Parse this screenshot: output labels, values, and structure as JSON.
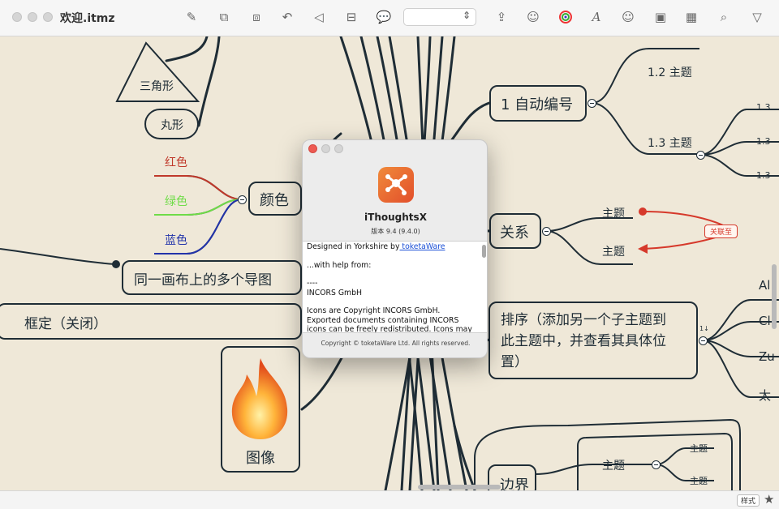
{
  "window": {
    "title": "欢迎.itmz"
  },
  "toolbar": {
    "icons": [
      "edit-icon",
      "add-child-icon",
      "add-sibling-icon",
      "undo-icon",
      "redo-icon",
      "topic-layout-icon",
      "callout-icon",
      "style-select",
      "share-icon",
      "sticker-icon",
      "color-wheel-icon",
      "font-icon",
      "emoji-icon",
      "image-icon",
      "calendar-icon",
      "search-icon",
      "filter-icon"
    ]
  },
  "mindmap": {
    "triangle": "三角形",
    "pill": "丸形",
    "color_node": "颜色",
    "red": "红色",
    "green": "绿色",
    "blue": "蓝色",
    "multi_maps": "同一画布上的多个导图",
    "boundary": "框定（关闭）",
    "image_node": "图像",
    "auto_number": "1 自动编号",
    "sub_1_2": "1.2 主题",
    "sub_1_3": "1.3 主题",
    "sub_1_3_children": [
      "1.3",
      "1.3",
      "1.3"
    ],
    "relation": "关系",
    "relation_topic_a": "主题",
    "relation_topic_b": "主题",
    "relation_label": "关联至",
    "sort_node": "排序（添加另一个子主题到此主题中，并查看其具体位置）",
    "sort_lines": [
      "排序（添加另一个子主题到",
      "此主题中，并查看其具体位",
      "置）"
    ],
    "sort_children": [
      "Al",
      "Cl",
      "Zu",
      "太"
    ],
    "sort_badge": "1↓",
    "border_node": "边界",
    "border_topic": "主题",
    "border_sub_topics": [
      "主题",
      "主题"
    ]
  },
  "about": {
    "app_name": "iThoughtsX",
    "version": "版本 9.4 (9.4.0)",
    "credits_prefix": "Designed in Yorkshire by",
    "credits_link": " toketaWare",
    "help_line": "...with help from:",
    "dashes": "----",
    "incors": "INCORS GmbH",
    "icons_note": "Icons are Copyright INCORS GmbH. Exported documents containing INCORS icons can be freely redistributed. Icons may not be extracted",
    "copyright": "Copyright © toketaWare Ltd. All rights reserved."
  },
  "statusbar": {
    "style_label": "样式"
  },
  "colors": {
    "red": "#c0392b",
    "green": "#6fdc48",
    "blue": "#2233aa",
    "node_stroke": "#1f2d36",
    "canvas": "#efe8d8",
    "relation": "#d6392b"
  }
}
